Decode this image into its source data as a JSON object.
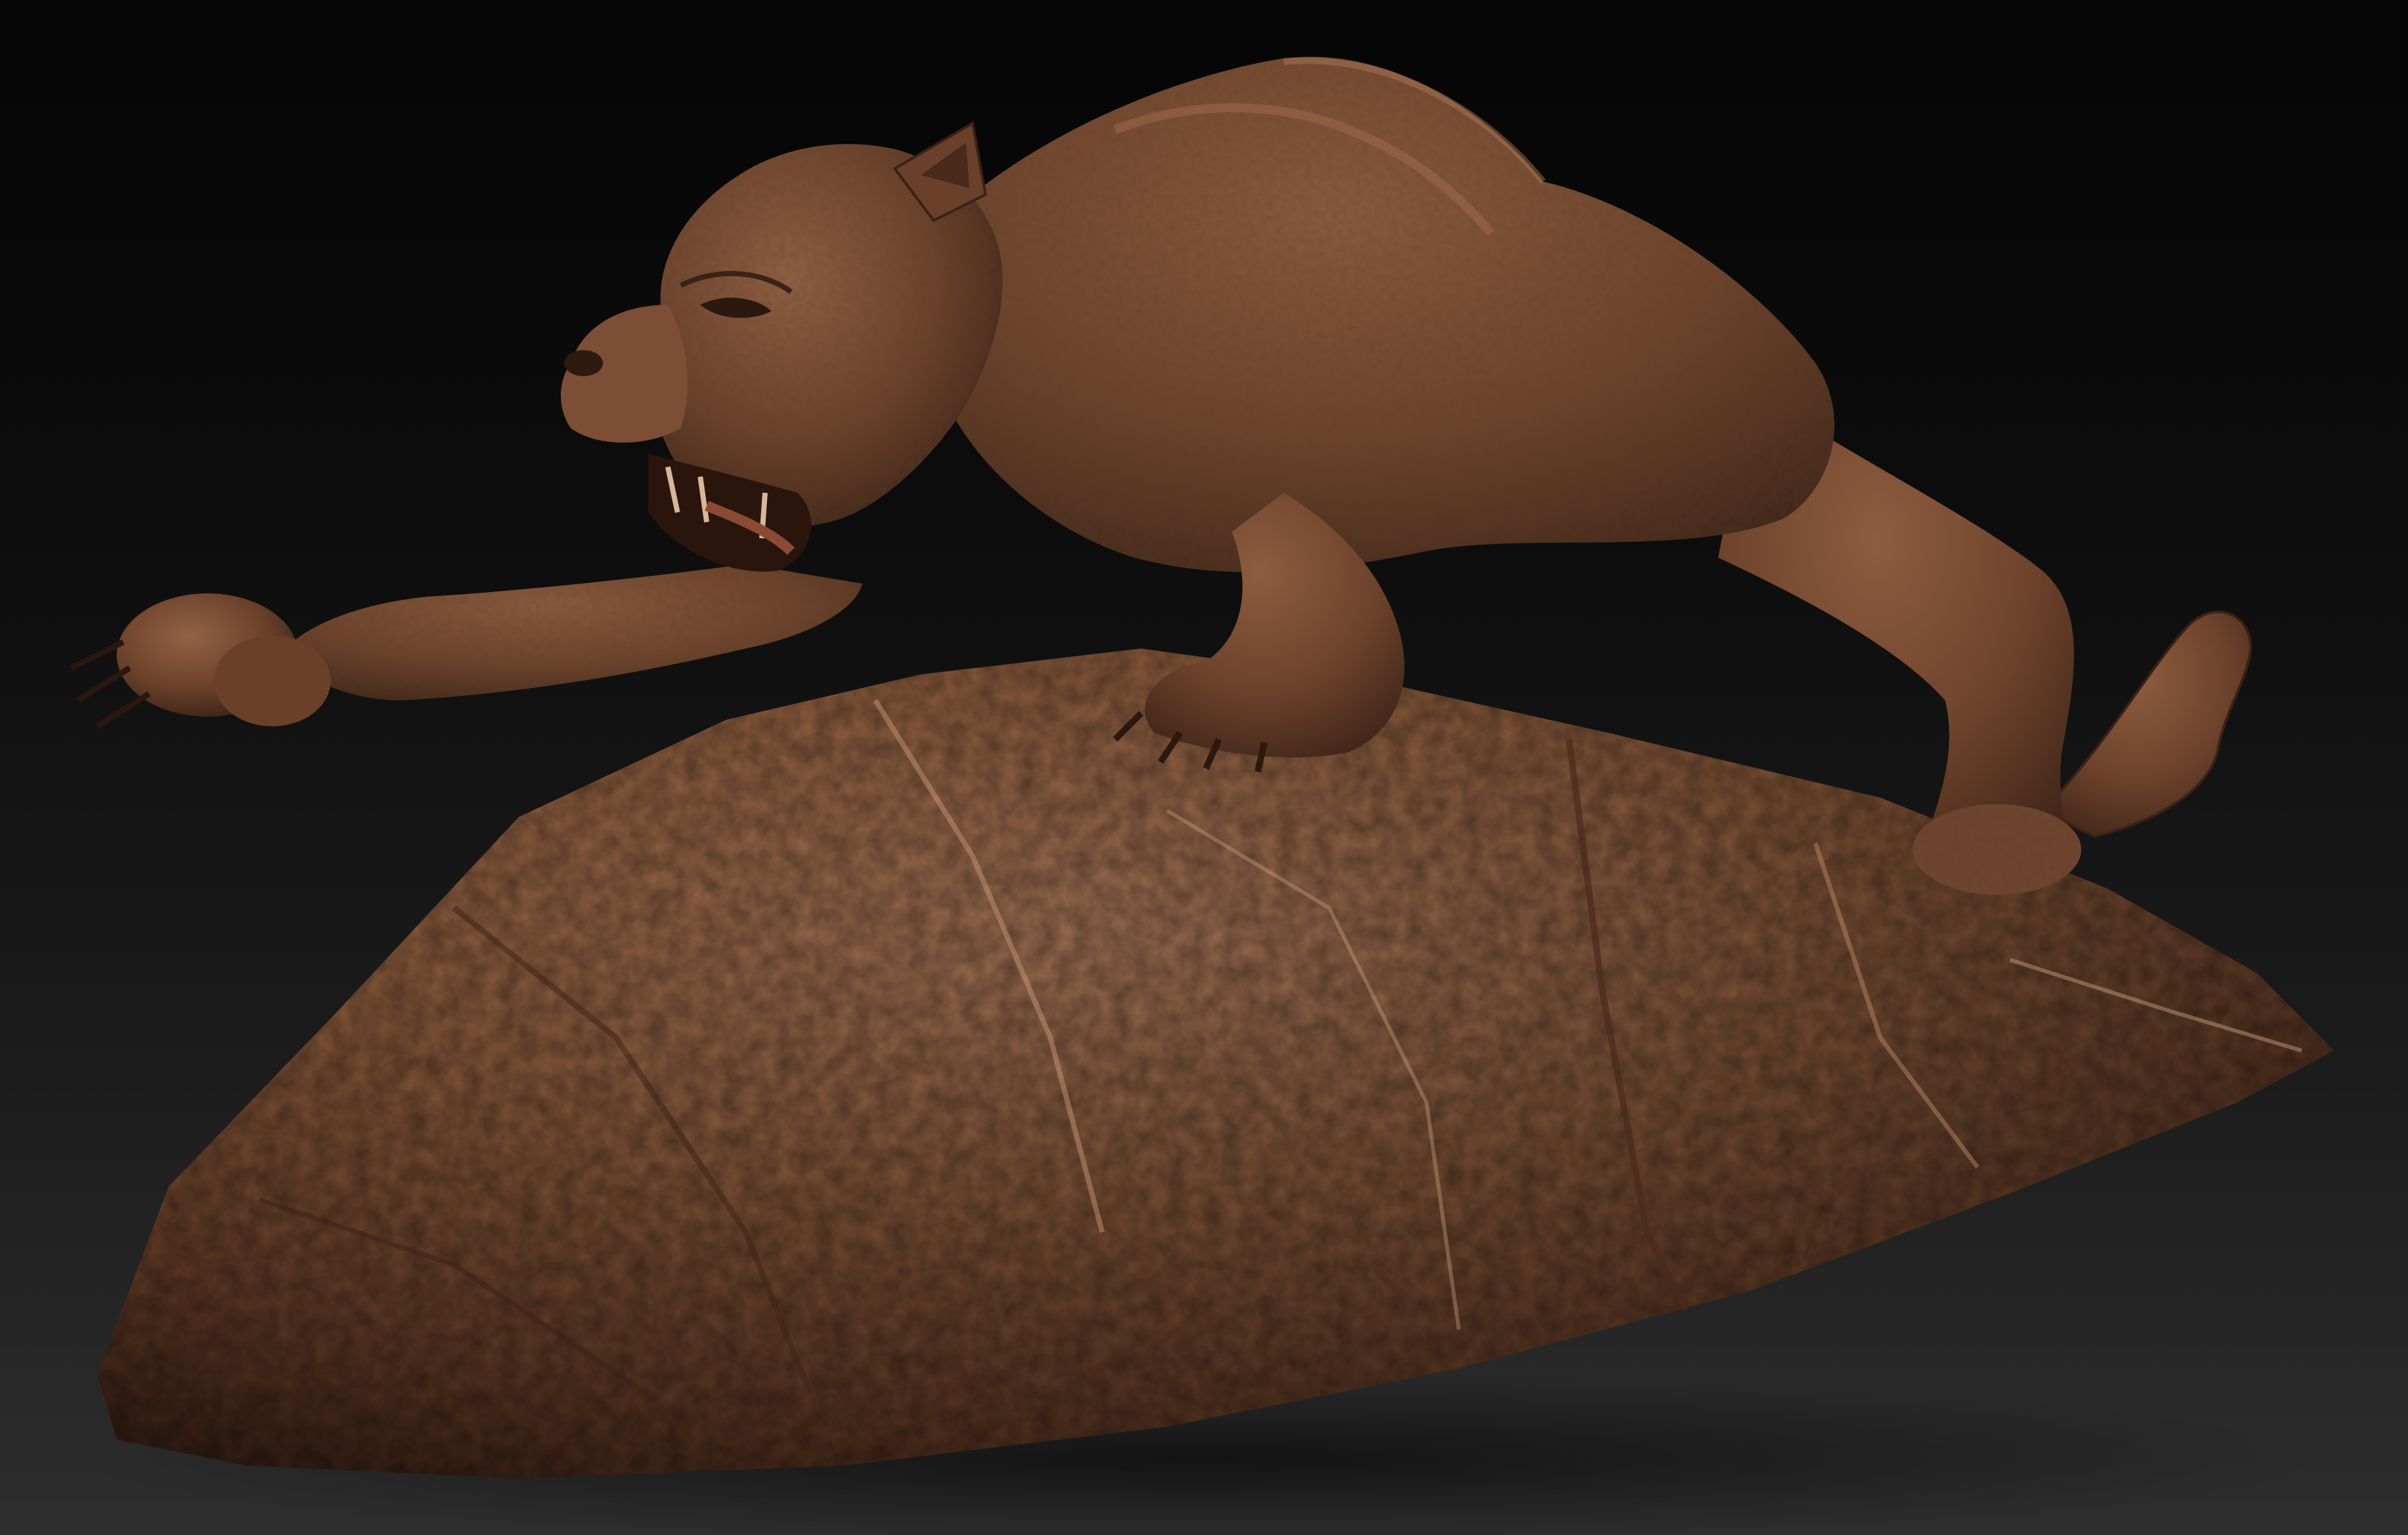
{
  "scene": {
    "subject": "panther-on-rock-sculpt",
    "colors": {
      "background_top": "#050505",
      "background_bottom": "#2e2e2e",
      "clay_light": "#b27a57",
      "clay_mid": "#7f5037",
      "clay_dark": "#3e2418"
    }
  }
}
